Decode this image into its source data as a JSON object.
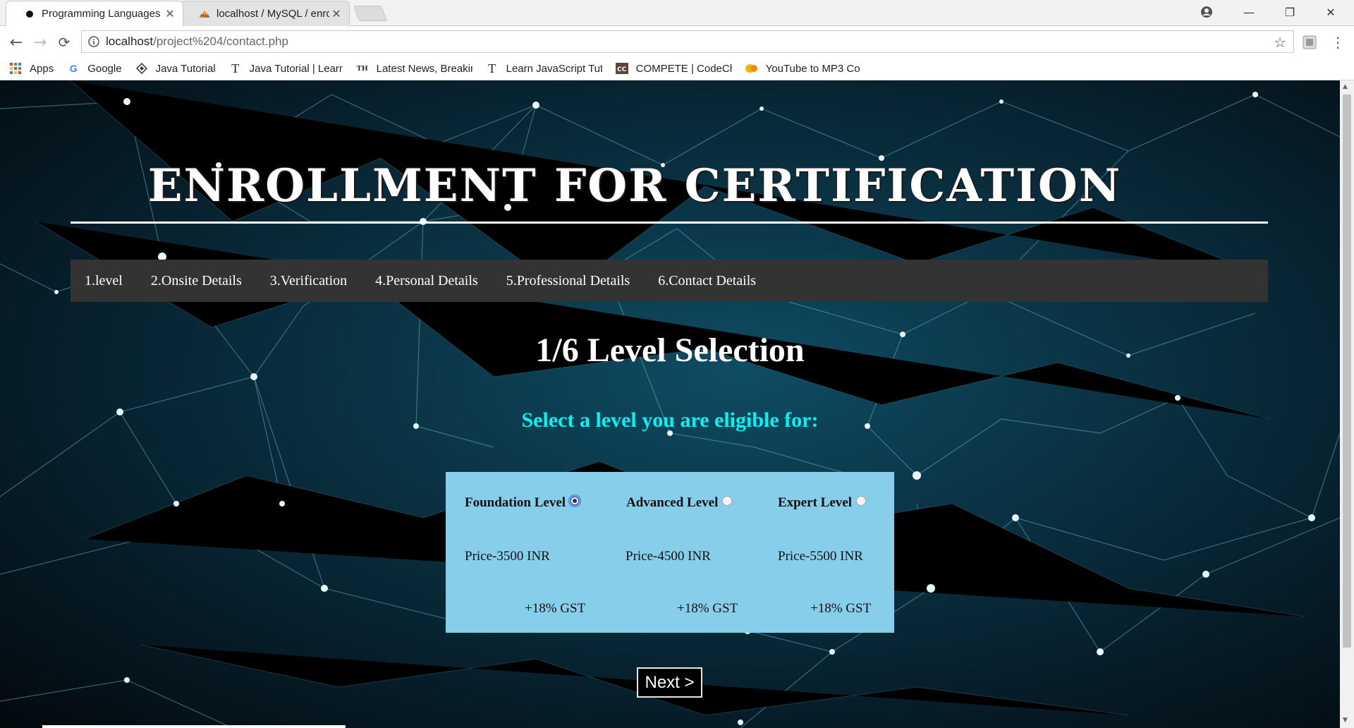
{
  "browser": {
    "tabs": [
      {
        "title": "Programming Languages",
        "icon": "circle-icon",
        "active": true
      },
      {
        "title": "localhost / MySQL / enro",
        "icon": "phpmyadmin-icon",
        "active": false
      }
    ],
    "url_host": "localhost",
    "url_path": "/project%204/contact.php",
    "bookmarks": [
      {
        "label": "Apps",
        "icon": "apps-grid-icon"
      },
      {
        "label": "Google",
        "icon": "google-icon"
      },
      {
        "label": "Java Tutorial",
        "icon": "diamond-icon"
      },
      {
        "label": "Java Tutorial | Learn",
        "icon": "t-icon"
      },
      {
        "label": "Latest News, Breakin",
        "icon": "th-icon"
      },
      {
        "label": "Learn JavaScript Tut",
        "icon": "t-icon"
      },
      {
        "label": "COMPETE | CodeChe",
        "icon": "codechef-icon"
      },
      {
        "label": "YouTube to MP3 Co",
        "icon": "converter-icon"
      }
    ]
  },
  "page": {
    "title": "ENROLLMENT FOR CERTIFICATION",
    "steps": [
      "1.level",
      "2.Onsite Details",
      "3.Verification",
      "4.Personal Details",
      "5.Professional Details",
      "6.Contact Details"
    ],
    "heading": "1/6 Level Selection",
    "subheading": "Select a level you are eligible for:",
    "levels": [
      {
        "name": "Foundation Level",
        "price": "Price-3500 INR",
        "gst": "+18% GST",
        "selected": true
      },
      {
        "name": "Advanced Level",
        "price": "Price-4500 INR",
        "gst": "+18% GST",
        "selected": false
      },
      {
        "name": "Expert Level",
        "price": "Price-5500 INR",
        "gst": "+18% GST",
        "selected": false
      }
    ],
    "next_label": "Next >"
  },
  "colors": {
    "subheading": "#00f5f5",
    "level_box": "#87ceeb",
    "step_nav": "#333333"
  }
}
